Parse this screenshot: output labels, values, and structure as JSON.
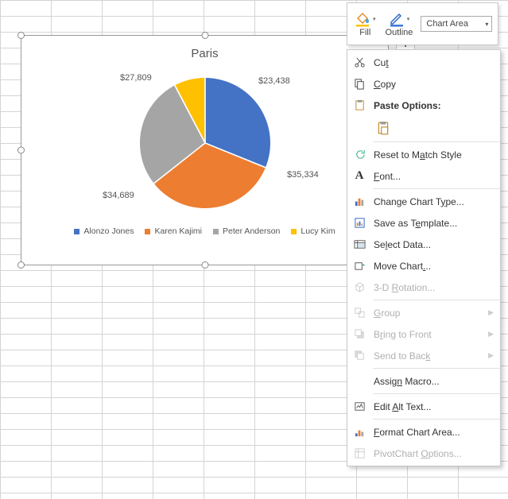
{
  "mini_toolbar": {
    "fill": "Fill",
    "outline": "Outline",
    "selector": "Chart Area"
  },
  "chart_data": {
    "type": "pie",
    "title": "Paris",
    "series": [
      {
        "name": "Alonzo Jones",
        "value": 23438,
        "label": "$23,438",
        "color": "#4472C4"
      },
      {
        "name": "Karen Kajimi",
        "value": 35334,
        "label": "$35,334",
        "color": "#ED7D31"
      },
      {
        "name": "Peter Anderson",
        "value": 34689,
        "label": "$34,689",
        "color": "#A5A5A5"
      },
      {
        "name": "Lucy Kim",
        "value": 27809,
        "label": "$27,809",
        "color": "#FFC000"
      }
    ]
  },
  "context_menu": {
    "cut": "Cut",
    "copy": "Copy",
    "paste_options": "Paste Options:",
    "reset": "Reset to Match Style",
    "font": "Font...",
    "change_chart_type": "Change Chart Type...",
    "save_template": "Save as Template...",
    "select_data": "Select Data...",
    "move_chart": "Move Chart...",
    "rotation_3d": "3-D Rotation...",
    "group": "Group",
    "bring_front": "Bring to Front",
    "send_back": "Send to Back",
    "assign_macro": "Assign Macro...",
    "edit_alt": "Edit Alt Text...",
    "format_chart": "Format Chart Area...",
    "pivot_options": "PivotChart Options..."
  }
}
